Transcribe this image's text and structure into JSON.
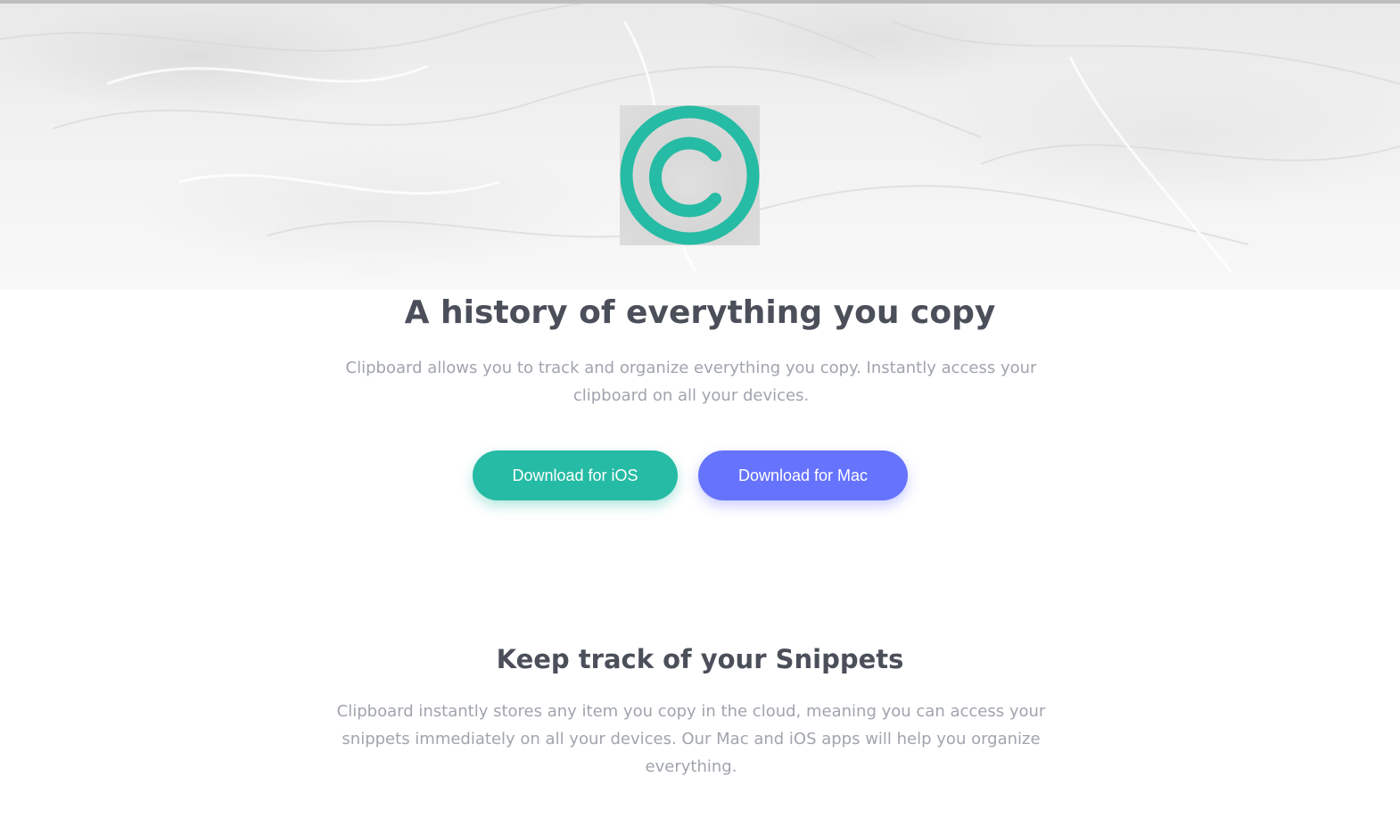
{
  "hero": {
    "logo_icon": "clipboard-c-logo-icon",
    "accent_color": "#26bba4",
    "headline": "A history of everything you copy",
    "intro": "Clipboard allows you to track and organize everything you copy. Instantly access your clipboard on all your devices."
  },
  "buttons": {
    "ios_label": "Download for iOS",
    "ios_color": "#26bba4",
    "mac_label": "Download for Mac",
    "mac_color": "#6673fd"
  },
  "snippets": {
    "title": "Keep track of your Snippets",
    "text": "Clipboard instantly stores any item you copy in the cloud, meaning you can access your snippets immediately on all your devices. Our Mac and iOS apps will help you organize everything."
  }
}
